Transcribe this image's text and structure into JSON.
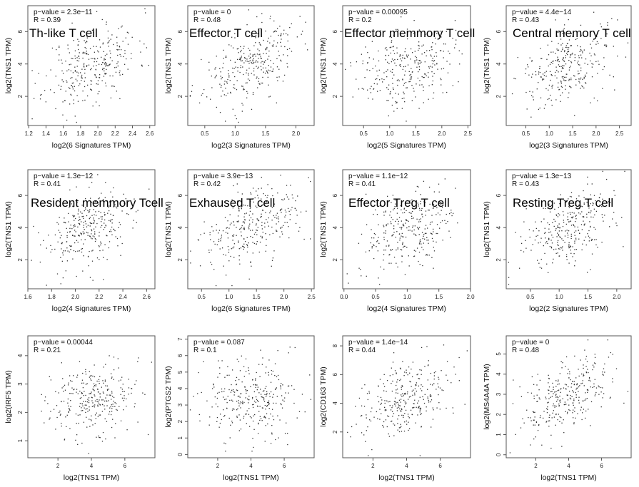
{
  "figure": {
    "description": "Correlation scatter plots of TNS1 expression with T cell subtype signatures and macrophage markers",
    "colors": {
      "point": "#333333",
      "frame": "#555555",
      "background": "#ffffff"
    }
  },
  "chart_data": [
    {
      "type": "scatter",
      "id": "th-like",
      "label": "Th-like T cell",
      "pvalue": "p−value = 2.3e−11",
      "r": "R = 0.39",
      "r_value": 0.39,
      "xlabel": "log2(6 Signatures TPM)",
      "ylabel": "log2(TNS1 TPM)",
      "xlim": [
        1.19,
        2.66
      ],
      "ylim": [
        0.2,
        7.6
      ],
      "xticks": [
        1.2,
        1.4,
        1.6,
        1.8,
        2.0,
        2.2,
        2.4,
        2.6
      ],
      "xtick_labels": [
        "1.2",
        "1.4",
        "1.6",
        "1.8",
        "2.0",
        "2.2",
        "2.4",
        "2.6"
      ],
      "yticks": [
        2,
        4,
        6
      ],
      "ytick_labels": [
        "2",
        "4",
        "6"
      ],
      "x_range": [
        1.24,
        2.62
      ],
      "y_range": [
        0.4,
        7.5
      ],
      "n_points": 300,
      "seed": 11
    },
    {
      "type": "scatter",
      "id": "effector",
      "label": "Effector T cell",
      "pvalue": "p−value = 0",
      "r": "R = 0.48",
      "r_value": 0.48,
      "xlabel": "log2(3 Signatures TPM)",
      "ylabel": "log2(TNS1 TPM)",
      "xlim": [
        0.22,
        2.3
      ],
      "ylim": [
        0.2,
        7.6
      ],
      "xticks": [
        0.5,
        1.0,
        1.5,
        2.0
      ],
      "xtick_labels": [
        "0.5",
        "1.0",
        "1.5",
        "2.0"
      ],
      "yticks": [
        2,
        4,
        6
      ],
      "ytick_labels": [
        "2",
        "4",
        "6"
      ],
      "x_range": [
        0.26,
        2.22
      ],
      "y_range": [
        0.4,
        7.5
      ],
      "n_points": 300,
      "seed": 23
    },
    {
      "type": "scatter",
      "id": "effector-memory",
      "label": "Effector memmory T cell",
      "pvalue": "p−value = 0.00095",
      "r": "R = 0.2",
      "r_value": 0.2,
      "xlabel": "log2(5 Signatures TPM)",
      "ylabel": "log2(TNS1 TPM)",
      "xlim": [
        0.1,
        2.55
      ],
      "ylim": [
        0.2,
        7.6
      ],
      "xticks": [
        0.5,
        1.0,
        1.5,
        2.0,
        2.5
      ],
      "xtick_labels": [
        "0.5",
        "1.0",
        "1.5",
        "2.0",
        "2.5"
      ],
      "yticks": [
        2,
        4,
        6
      ],
      "ytick_labels": [
        "2",
        "4",
        "6"
      ],
      "x_range": [
        0.15,
        2.48
      ],
      "y_range": [
        0.4,
        7.5
      ],
      "n_points": 300,
      "seed": 37
    },
    {
      "type": "scatter",
      "id": "central-memory",
      "label": "Central memory T cell",
      "pvalue": "p−value = 4.4e−14",
      "r": "R = 0.43",
      "r_value": 0.43,
      "xlabel": "log2(3 Signatures TPM)",
      "ylabel": "log2(TNS1 TPM)",
      "xlim": [
        0.08,
        2.75
      ],
      "ylim": [
        0.2,
        7.6
      ],
      "xticks": [
        0.5,
        1.0,
        1.5,
        2.0,
        2.5
      ],
      "xtick_labels": [
        "0.5",
        "1.0",
        "1.5",
        "2.0",
        "2.5"
      ],
      "yticks": [
        2,
        4,
        6
      ],
      "ytick_labels": [
        "2",
        "4",
        "6"
      ],
      "x_range": [
        0.12,
        2.68
      ],
      "y_range": [
        0.4,
        7.5
      ],
      "n_points": 300,
      "seed": 41
    },
    {
      "type": "scatter",
      "id": "resident-memory",
      "label": "Resident memmory Tcell",
      "pvalue": "p−value = 1.3e−12",
      "r": "R = 0.41",
      "r_value": 0.41,
      "xlabel": "log2(4 Signatures TPM)",
      "ylabel": "log2(TNS1 TPM)",
      "xlim": [
        1.6,
        2.67
      ],
      "ylim": [
        0.2,
        7.6
      ],
      "xticks": [
        1.6,
        1.8,
        2.0,
        2.2,
        2.4,
        2.6
      ],
      "xtick_labels": [
        "1.6",
        "1.8",
        "2.0",
        "2.2",
        "2.4",
        "2.6"
      ],
      "yticks": [
        2,
        4,
        6
      ],
      "ytick_labels": [
        "2",
        "4",
        "6"
      ],
      "x_range": [
        1.63,
        2.62
      ],
      "y_range": [
        0.4,
        7.5
      ],
      "n_points": 300,
      "seed": 53
    },
    {
      "type": "scatter",
      "id": "exhausted",
      "label": "Exhaused T cell",
      "pvalue": "p−value = 3.9e−13",
      "r": "R = 0.42",
      "r_value": 0.42,
      "xlabel": "log2(6 Signatures TPM)",
      "ylabel": "log2(TNS1 TPM)",
      "xlim": [
        0.25,
        2.55
      ],
      "ylim": [
        0.2,
        7.6
      ],
      "xticks": [
        0.5,
        1.0,
        1.5,
        2.0,
        2.5
      ],
      "xtick_labels": [
        "0.5",
        "1.0",
        "1.5",
        "2.0",
        "2.5"
      ],
      "yticks": [
        2,
        4,
        6
      ],
      "ytick_labels": [
        "2",
        "4",
        "6"
      ],
      "x_range": [
        0.3,
        2.48
      ],
      "y_range": [
        0.4,
        7.5
      ],
      "n_points": 300,
      "seed": 67
    },
    {
      "type": "scatter",
      "id": "effector-treg",
      "label": "Effector Treg T cell",
      "pvalue": "p−value = 1.1e−12",
      "r": "R = 0.41",
      "r_value": 0.41,
      "xlabel": "log2(4 Signatures TPM)",
      "ylabel": "log2(TNS1 TPM)",
      "xlim": [
        -0.02,
        2.0
      ],
      "ylim": [
        0.2,
        7.6
      ],
      "xticks": [
        0.0,
        0.5,
        1.0,
        1.5,
        2.0
      ],
      "xtick_labels": [
        "0.0",
        "0.5",
        "1.0",
        "1.5",
        "2.0"
      ],
      "yticks": [
        2,
        4,
        6
      ],
      "ytick_labels": [
        "2",
        "4",
        "6"
      ],
      "x_range": [
        0.05,
        1.96
      ],
      "y_range": [
        0.4,
        7.5
      ],
      "n_points": 300,
      "seed": 79
    },
    {
      "type": "scatter",
      "id": "resting-treg",
      "label": "Resting Treg T cell",
      "pvalue": "p−value = 1.3e−13",
      "r": "R = 0.43",
      "r_value": 0.43,
      "xlabel": "log2(2 Signatures TPM)",
      "ylabel": "log2(TNS1 TPM)",
      "xlim": [
        0.08,
        2.25
      ],
      "ylim": [
        0.2,
        7.6
      ],
      "xticks": [
        0.5,
        1.0,
        1.5,
        2.0
      ],
      "xtick_labels": [
        "0.5",
        "1.0",
        "1.5",
        "2.0"
      ],
      "yticks": [
        2,
        4,
        6
      ],
      "ytick_labels": [
        "2",
        "4",
        "6"
      ],
      "x_range": [
        0.12,
        2.2
      ],
      "y_range": [
        0.4,
        7.5
      ],
      "n_points": 300,
      "seed": 83
    },
    {
      "type": "scatter",
      "id": "irf5",
      "label": "",
      "pvalue": "p−value = 0.00044",
      "r": "R = 0.21",
      "r_value": 0.21,
      "xlabel": "log2(TNS1 TPM)",
      "ylabel": "log2(IRF5 TPM)",
      "xlim": [
        0.2,
        7.8
      ],
      "ylim": [
        0.4,
        4.7
      ],
      "xticks": [
        2,
        4,
        6
      ],
      "xtick_labels": [
        "2",
        "4",
        "6"
      ],
      "yticks": [
        1,
        2,
        3,
        4
      ],
      "ytick_labels": [
        "1",
        "2",
        "3",
        "4"
      ],
      "x_range": [
        0.35,
        7.6
      ],
      "y_range": [
        0.55,
        4.35
      ],
      "n_points": 300,
      "seed": 97
    },
    {
      "type": "scatter",
      "id": "ptgs2",
      "label": "",
      "pvalue": "p−value = 0.087",
      "r": "R = 0.1",
      "r_value": 0.1,
      "xlabel": "log2(TNS1 TPM)",
      "ylabel": "log2(PTGS2 TPM)",
      "xlim": [
        0.2,
        7.8
      ],
      "ylim": [
        -0.2,
        7.2
      ],
      "xticks": [
        2,
        4,
        6
      ],
      "xtick_labels": [
        "2",
        "4",
        "6"
      ],
      "yticks": [
        0,
        1,
        2,
        3,
        4,
        5,
        6,
        7
      ],
      "ytick_labels": [
        "0",
        "1",
        "2",
        "3",
        "4",
        "5",
        "6",
        "7"
      ],
      "x_range": [
        0.35,
        7.6
      ],
      "y_range": [
        0.05,
        6.9
      ],
      "n_points": 300,
      "seed": 101
    },
    {
      "type": "scatter",
      "id": "cd163",
      "label": "",
      "pvalue": "p−value = 1.4e−14",
      "r": "R = 0.44",
      "r_value": 0.44,
      "xlabel": "log2(TNS1 TPM)",
      "ylabel": "log2(CD163 TPM)",
      "xlim": [
        0.2,
        7.8
      ],
      "ylim": [
        0.2,
        8.7
      ],
      "xticks": [
        2,
        4,
        6
      ],
      "xtick_labels": [
        "2",
        "4",
        "6"
      ],
      "yticks": [
        2,
        4,
        6,
        8
      ],
      "ytick_labels": [
        "2",
        "4",
        "6",
        "8"
      ],
      "x_range": [
        0.35,
        7.6
      ],
      "y_range": [
        0.35,
        8.3
      ],
      "n_points": 300,
      "seed": 113
    },
    {
      "type": "scatter",
      "id": "ms4a4a",
      "label": "",
      "pvalue": "p−value = 0",
      "r": "R = 0.48",
      "r_value": 0.48,
      "xlabel": "log2(TNS1 TPM)",
      "ylabel": "log2(MS4A4A TPM)",
      "xlim": [
        0.2,
        7.8
      ],
      "ylim": [
        -0.15,
        5.9
      ],
      "xticks": [
        2,
        4,
        6
      ],
      "xtick_labels": [
        "2",
        "4",
        "6"
      ],
      "yticks": [
        0,
        1,
        2,
        3,
        4,
        5
      ],
      "ytick_labels": [
        "0",
        "1",
        "2",
        "3",
        "4",
        "5"
      ],
      "x_range": [
        0.3,
        7.6
      ],
      "y_range": [
        0.1,
        5.7
      ],
      "n_points": 300,
      "seed": 127
    }
  ]
}
